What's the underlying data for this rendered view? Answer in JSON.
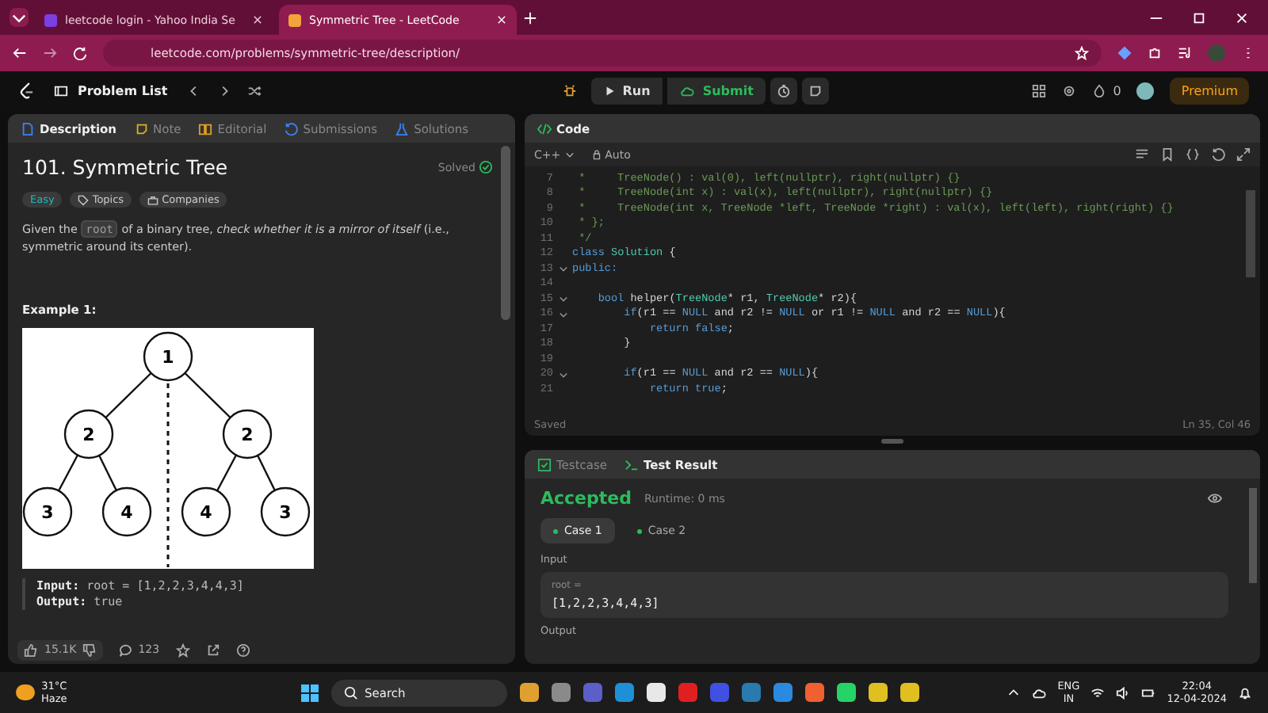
{
  "browser": {
    "tabs": [
      {
        "title": "leetcode login - Yahoo India Se",
        "selected": false
      },
      {
        "title": "Symmetric Tree - LeetCode",
        "selected": true
      }
    ],
    "url": "leetcode.com/problems/symmetric-tree/description/"
  },
  "nav": {
    "problem_list": "Problem List",
    "run": "Run",
    "submit": "Submit",
    "streak": "0",
    "premium": "Premium"
  },
  "left_tabs": [
    {
      "label": "Description",
      "selected": true
    },
    {
      "label": "Note",
      "selected": false
    },
    {
      "label": "Editorial",
      "selected": false
    },
    {
      "label": "Submissions",
      "selected": false
    },
    {
      "label": "Solutions",
      "selected": false
    }
  ],
  "problem": {
    "title": "101. Symmetric Tree",
    "status": "Solved",
    "tags": [
      {
        "label": "Easy",
        "kind": "difficulty"
      },
      {
        "label": "Topics",
        "kind": "topics"
      },
      {
        "label": "Companies",
        "kind": "companies"
      }
    ],
    "description": [
      {
        "text": "Given the ",
        "kind": "plain"
      },
      {
        "text": "root",
        "kind": "code"
      },
      {
        "text": " of a binary tree, ",
        "kind": "plain"
      },
      {
        "text": "check whether it is a mirror of itself",
        "kind": "italic"
      },
      {
        "text": " (i.e., symmetric around its center).",
        "kind": "plain"
      }
    ],
    "example": {
      "heading": "Example 1:",
      "tree": [
        "1",
        "2",
        "2",
        "3",
        "4",
        "4",
        "3"
      ],
      "input_label": "Input:",
      "input": "root = [1,2,2,3,4,4,3]",
      "output_label": "Output:",
      "output": "true"
    },
    "likes": "15.1K",
    "comments": "123"
  },
  "code": {
    "title": "Code",
    "language": "C++",
    "mode": "Auto",
    "status": "Saved",
    "cursor": "Ln 35, Col 46",
    "lines": [
      {
        "number": "7",
        "fold": false,
        "segments": [
          {
            "text": " *     TreeNode() : val(0), left(nullptr), right(nullptr) {}",
            "kind": "comment"
          }
        ]
      },
      {
        "number": "8",
        "fold": false,
        "segments": [
          {
            "text": " *     TreeNode(int x) : val(x), left(nullptr), right(nullptr) {}",
            "kind": "comment"
          }
        ]
      },
      {
        "number": "9",
        "fold": false,
        "segments": [
          {
            "text": " *     TreeNode(int x, TreeNode *left, TreeNode *right) : val(x), left(left), right(right) {}",
            "kind": "comment"
          }
        ]
      },
      {
        "number": "10",
        "fold": false,
        "segments": [
          {
            "text": " * };",
            "kind": "comment"
          }
        ]
      },
      {
        "number": "11",
        "fold": false,
        "segments": [
          {
            "text": " */",
            "kind": "comment"
          }
        ]
      },
      {
        "number": "12",
        "fold": false,
        "segments": [
          {
            "text": "class",
            "kind": "keyword"
          },
          {
            "text": " Solution",
            "kind": "type"
          },
          {
            "text": " {",
            "kind": "plain"
          }
        ]
      },
      {
        "number": "13",
        "fold": true,
        "segments": [
          {
            "text": "public:",
            "kind": "keyword"
          }
        ]
      },
      {
        "number": "14",
        "fold": false
      },
      {
        "number": "15",
        "fold": true,
        "segments": [
          {
            "text": "    bool",
            "kind": "keyword"
          },
          {
            "text": " helper(",
            "kind": "plain"
          },
          {
            "text": "TreeNode",
            "kind": "type"
          },
          {
            "text": "* r1, ",
            "kind": "plain"
          },
          {
            "text": "TreeNode",
            "kind": "type"
          },
          {
            "text": "* r2){",
            "kind": "plain"
          }
        ]
      },
      {
        "number": "16",
        "fold": true,
        "segments": [
          {
            "text": "        if",
            "kind": "keyword"
          },
          {
            "text": "(r1 == ",
            "kind": "plain"
          },
          {
            "text": "NULL",
            "kind": "constant"
          },
          {
            "text": " and r2 != ",
            "kind": "plain"
          },
          {
            "text": "NULL",
            "kind": "constant"
          },
          {
            "text": " or r1 != ",
            "kind": "plain"
          },
          {
            "text": "NULL",
            "kind": "constant"
          },
          {
            "text": " and r2 == ",
            "kind": "plain"
          },
          {
            "text": "NULL",
            "kind": "constant"
          },
          {
            "text": "){",
            "kind": "plain"
          }
        ]
      },
      {
        "number": "17",
        "fold": false,
        "segments": [
          {
            "text": "            return",
            "kind": "keyword"
          },
          {
            "text": " false",
            "kind": "constant"
          },
          {
            "text": ";",
            "kind": "plain"
          }
        ]
      },
      {
        "number": "18",
        "fold": false,
        "segments": [
          {
            "text": "        }",
            "kind": "plain"
          }
        ]
      },
      {
        "number": "19",
        "fold": false
      },
      {
        "number": "20",
        "fold": true,
        "segments": [
          {
            "text": "        if",
            "kind": "keyword"
          },
          {
            "text": "(r1 == ",
            "kind": "plain"
          },
          {
            "text": "NULL",
            "kind": "constant"
          },
          {
            "text": " and r2 == ",
            "kind": "plain"
          },
          {
            "text": "NULL",
            "kind": "constant"
          },
          {
            "text": "){",
            "kind": "plain"
          }
        ]
      },
      {
        "number": "21",
        "fold": false,
        "segments": [
          {
            "text": "            return",
            "kind": "keyword"
          },
          {
            "text": " true",
            "kind": "constant"
          },
          {
            "text": ";",
            "kind": "plain"
          }
        ]
      }
    ]
  },
  "result": {
    "tabs": [
      {
        "label": "Testcase",
        "selected": false
      },
      {
        "label": "Test Result",
        "selected": true
      }
    ],
    "verdict": "Accepted",
    "runtime": "Runtime: 0 ms",
    "cases": [
      {
        "label": "Case 1",
        "selected": true
      },
      {
        "label": "Case 2",
        "selected": false
      }
    ],
    "input_label": "Input",
    "param": "root =",
    "value": "[1,2,2,3,4,4,3]",
    "output_label": "Output"
  },
  "taskbar": {
    "temperature": "31°C",
    "weather": "Haze",
    "search": "Search",
    "language": "ENG",
    "region": "IN",
    "time": "22:04",
    "date": "12-04-2024"
  }
}
